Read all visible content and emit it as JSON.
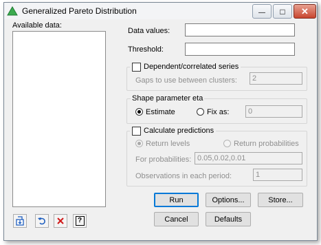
{
  "window": {
    "title": "Generalized Pareto Distribution",
    "controls": {
      "minimize": "—",
      "maximize": "□",
      "close": "✕"
    }
  },
  "available_data": {
    "label": "Available data:"
  },
  "data_values": {
    "label": "Data values:",
    "value": ""
  },
  "threshold": {
    "label": "Threshold:",
    "value": ""
  },
  "dependent": {
    "label": "Dependent/correlated series",
    "checked": false,
    "gaps_label": "Gaps to use between clusters:",
    "gaps_value": "2"
  },
  "shape": {
    "group_label": "Shape parameter eta",
    "estimate_label": "Estimate",
    "fix_label": "Fix as:",
    "fix_value": "0",
    "selected": "Estimate"
  },
  "predictions": {
    "label": "Calculate predictions",
    "checked": false,
    "return_levels_label": "Return levels",
    "return_probabilities_label": "Return probabilities",
    "selected": "Return levels",
    "for_probabilities_label": "For probabilities:",
    "for_probabilities_value": "0.05,0.02,0.01",
    "observations_label": "Observations in each period:",
    "observations_value": "1"
  },
  "buttons": {
    "run": "Run",
    "options": "Options...",
    "store": "Store...",
    "cancel": "Cancel",
    "defaults": "Defaults"
  },
  "toolbar_icons": [
    "select-data-icon",
    "undo-icon",
    "clear-icon",
    "help-icon"
  ],
  "toolbar_symbols": {
    "help": "?"
  },
  "colors": {
    "dialog_bg": "#f0f0f0",
    "default_button_border": "#0078d7",
    "close_button": "#c8452f",
    "icon_blue": "#1f5fbf",
    "icon_red": "#d01818",
    "app_icon_green": "#3cab4f"
  }
}
